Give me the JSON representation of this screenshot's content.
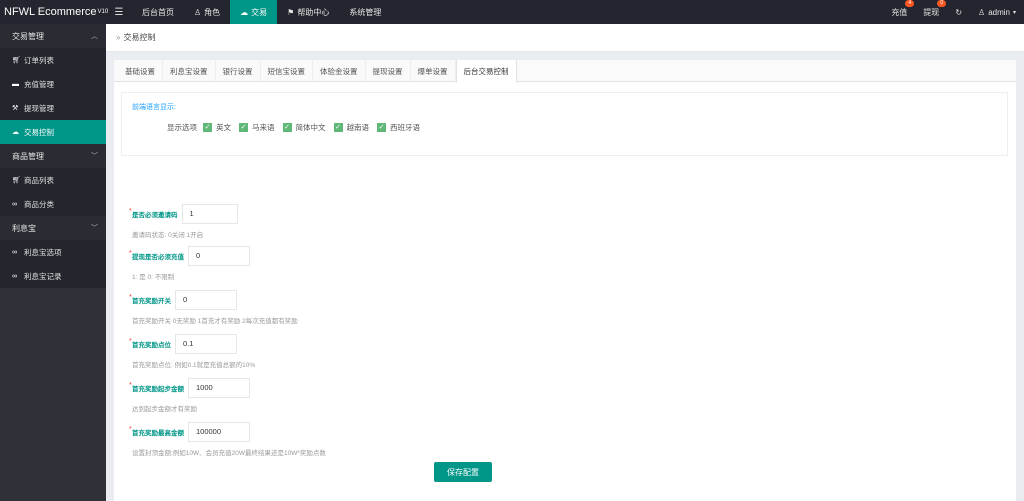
{
  "app": {
    "brand": "NFWL Ecommerce",
    "brand_version": "V10",
    "menu_toggle_icon": "hamburger-icon"
  },
  "topnav": [
    {
      "label": "后台首页",
      "icon": ""
    },
    {
      "label": "角色",
      "icon": "user-icon"
    },
    {
      "label": "交易",
      "icon": "cloud-icon"
    },
    {
      "label": "帮助中心",
      "icon": "flag-icon"
    },
    {
      "label": "系统管理",
      "icon": ""
    }
  ],
  "topright": {
    "recharge_label": "充值",
    "recharge_badge": "4",
    "withdraw_label": "提现",
    "withdraw_badge": "0",
    "refresh_icon": "refresh-icon",
    "user_label": "admin"
  },
  "sidebar": {
    "groups": [
      {
        "label": "交易管理",
        "items": [
          "订单列表",
          "充值管理",
          "提现管理",
          "交易控制"
        ]
      },
      {
        "label": "商品管理",
        "items": [
          "商品列表",
          "商品分类"
        ]
      },
      {
        "label": "利息宝",
        "items": [
          "利息宝选项",
          "利息宝记录"
        ]
      }
    ]
  },
  "breadcrumb": "交易控制",
  "tabs": [
    "基础设置",
    "利息宝设置",
    "银行设置",
    "短信宝设置",
    "体验金设置",
    "提现设置",
    "爆单设置",
    "后台交易控制"
  ],
  "lang": {
    "title": "前端语言显示:",
    "label": "显示选项",
    "options": [
      "英文",
      "马来语",
      "简体中文",
      "越南语",
      "西班牙语"
    ]
  },
  "fields": [
    {
      "label": "是否必须邀请码",
      "value": "1",
      "hint": "邀请码状态: 0关闭 1开启"
    },
    {
      "label": "提现是否必须充值",
      "value": "0",
      "hint": "1: 是 0: 不限制"
    },
    {
      "label": "首充奖励开关",
      "value": "0",
      "hint": "首充奖励开关 0无奖励 1首充才有奖励 2每次充值都有奖励"
    },
    {
      "label": "首充奖励点位",
      "value": "0.1",
      "hint": "首充奖励点位: 例如0.1就是充值总额的10%"
    },
    {
      "label": "首充奖励起步金额",
      "value": "1000",
      "hint": "达到起步金额才有奖励"
    },
    {
      "label": "首充奖励最高金额",
      "value": "100000",
      "hint": "设置封顶金额;例如10W、会员充值20W最终结果还是10W*奖励点数"
    }
  ],
  "save_label": "保存配置"
}
